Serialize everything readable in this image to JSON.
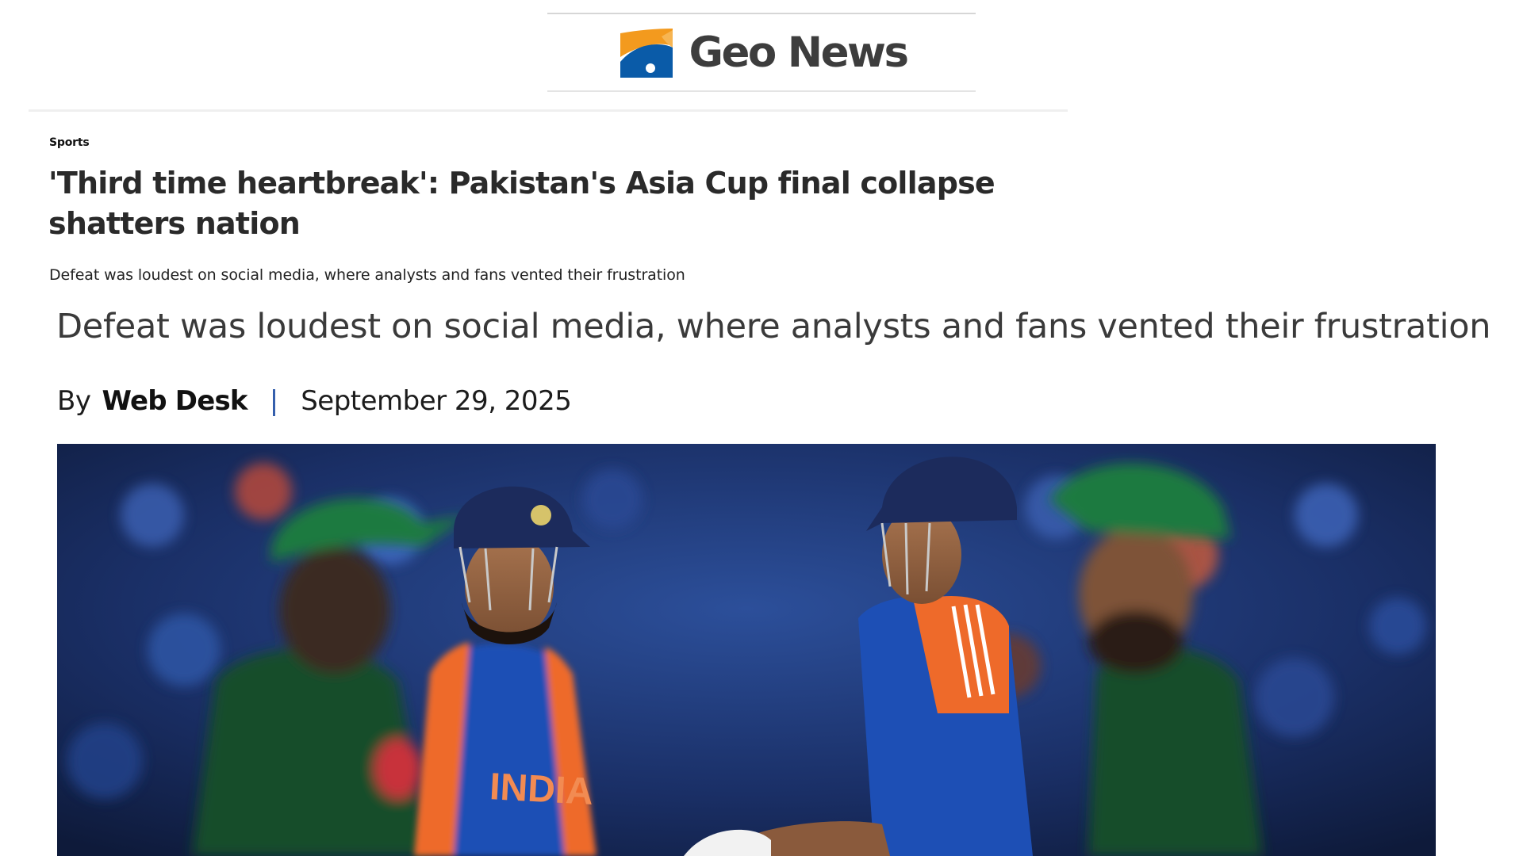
{
  "header": {
    "logo_text": "Geo News",
    "logo_colors": {
      "orange": "#f39a1e",
      "blue": "#0a5ba8",
      "text": "#3d3d3d"
    }
  },
  "article": {
    "category": "Sports",
    "headline": "'Third time heartbreak': Pakistan's Asia Cup final collapse shatters nation",
    "summary": "Defeat was loudest on social media, where analysts and fans vented their frustration"
  },
  "detail": {
    "summary": "Defeat was loudest on social media, where analysts and fans vented their frustration",
    "by_label": "By",
    "author": "Web Desk",
    "divider": "|",
    "date": "September 29, 2025"
  },
  "hero_image": {
    "jersey_text": "INDIA",
    "colors": {
      "india_blue": "#1d4fb5",
      "india_orange": "#ee6a2a",
      "pakistan_green": "#124d2c",
      "cap_green": "#1b7a3f"
    }
  }
}
